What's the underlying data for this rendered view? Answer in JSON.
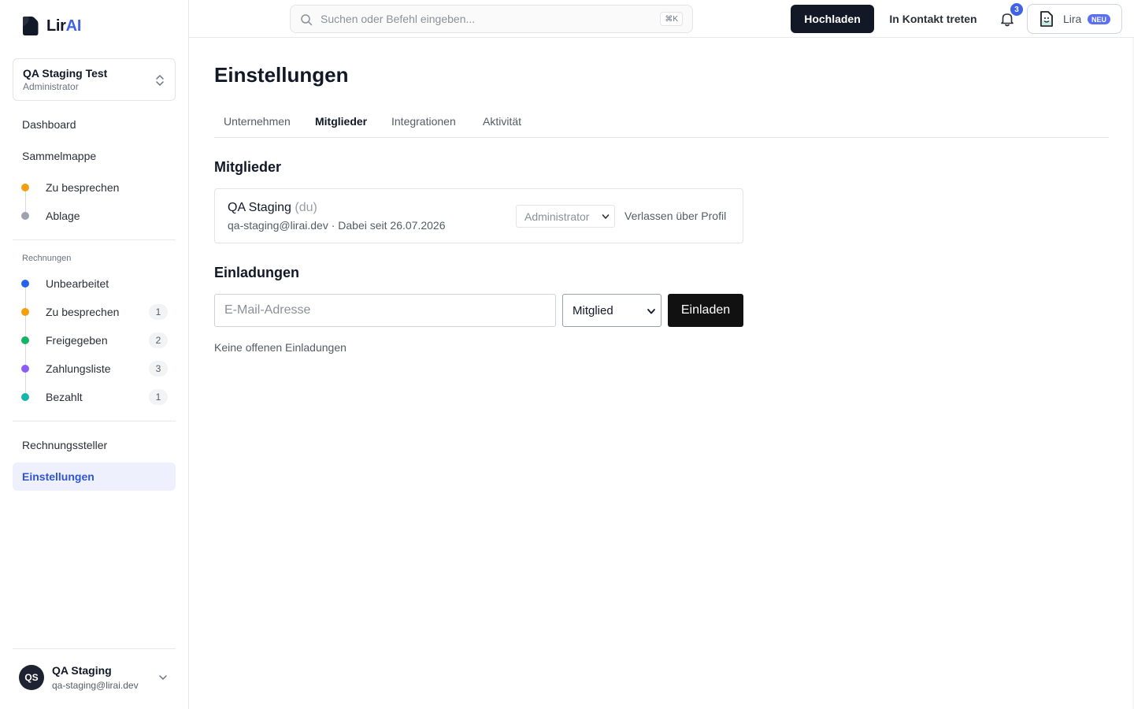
{
  "brand": {
    "name_main": "Lir",
    "name_accent": "AI"
  },
  "org": {
    "name": "QA Staging Test",
    "role": "Administrator"
  },
  "sidebar": {
    "dashboard": "Dashboard",
    "collection": "Sammelmappe",
    "collection_items": [
      {
        "label": "Zu besprechen",
        "color": "#f59e0b"
      },
      {
        "label": "Ablage",
        "color": "#9ca3af"
      }
    ],
    "invoices_section": "Rechnungen",
    "invoice_items": [
      {
        "label": "Unbearbeitet",
        "color": "#2563eb",
        "count": ""
      },
      {
        "label": "Zu besprechen",
        "color": "#f59e0b",
        "count": "1"
      },
      {
        "label": "Freigegeben",
        "color": "#16b364",
        "count": "2"
      },
      {
        "label": "Zahlungsliste",
        "color": "#8b5cf6",
        "count": "3"
      },
      {
        "label": "Bezahlt",
        "color": "#14b8a6",
        "count": "1"
      }
    ],
    "vendors": "Rechnungssteller",
    "settings": "Einstellungen"
  },
  "user": {
    "initials": "QS",
    "name": "QA Staging",
    "email": "qa-staging@lirai.dev"
  },
  "topbar": {
    "search_placeholder": "Suchen oder Befehl eingeben...",
    "search_shortcut": "⌘K",
    "upload": "Hochladen",
    "contact": "In Kontakt treten",
    "notifications_count": "3",
    "assistant_name": "Lira",
    "assistant_badge": "NEU"
  },
  "page": {
    "title": "Einstellungen",
    "tabs": [
      {
        "label": "Unternehmen",
        "active": false
      },
      {
        "label": "Mitglieder",
        "active": true
      },
      {
        "label": "Integrationen",
        "active": false
      },
      {
        "label": "Aktivität",
        "active": false
      }
    ],
    "members_heading": "Mitglieder",
    "member": {
      "name": "QA Staging",
      "you": "(du)",
      "meta": "qa-staging@lirai.dev · Dabei seit 26.07.2026",
      "role": "Administrator",
      "leave": "Verlassen über Profil"
    },
    "invites_heading": "Einladungen",
    "invite": {
      "email_placeholder": "E-Mail-Adresse",
      "role": "Mitglied",
      "button": "Einladen",
      "empty": "Keine offenen Einladungen"
    }
  },
  "colors": {
    "accent": "#3f63e6",
    "dark": "#131826"
  }
}
